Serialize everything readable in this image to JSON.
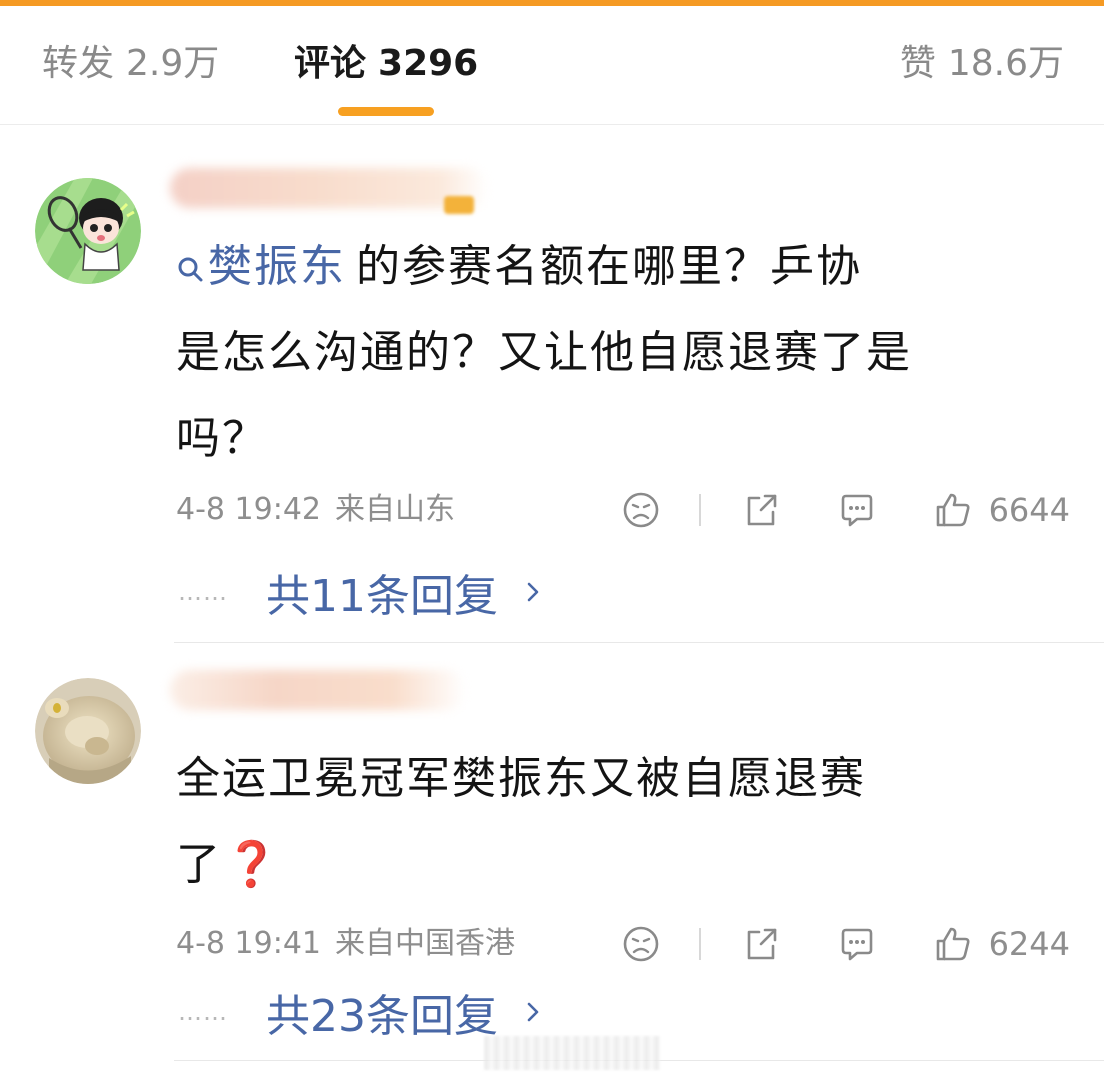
{
  "tabs": {
    "repost": {
      "label": "转发",
      "count": "2.9万"
    },
    "comment": {
      "label": "评论",
      "count": "3296"
    },
    "like": {
      "label": "赞",
      "count": "18.6万"
    }
  },
  "colors": {
    "accent": "#f7a021",
    "link": "#4867a6",
    "text": "#141414",
    "muted": "#8e8e8e"
  },
  "comments": [
    {
      "avatar_icon": "cartoon-boy-avatar",
      "topic": "樊振东",
      "text_line1": "的参赛名额在哪里？乒协",
      "text_line2": "是怎么沟通的？又让他自愿退赛了是",
      "text_line3": "吗？",
      "time": "4-8 19:42",
      "location": "来自山东",
      "likes": "6644",
      "replies_label": "共11条回复",
      "dots": "……"
    },
    {
      "avatar_icon": "plush-toy-avatar",
      "text_line1": "全运卫冕冠军樊振东又被自愿退赛",
      "text_line2": "了",
      "emoji": "❓",
      "time": "4-8 19:41",
      "location": "来自中国香港",
      "likes": "6244",
      "replies_label": "共23条回复",
      "dots": "……"
    }
  ]
}
